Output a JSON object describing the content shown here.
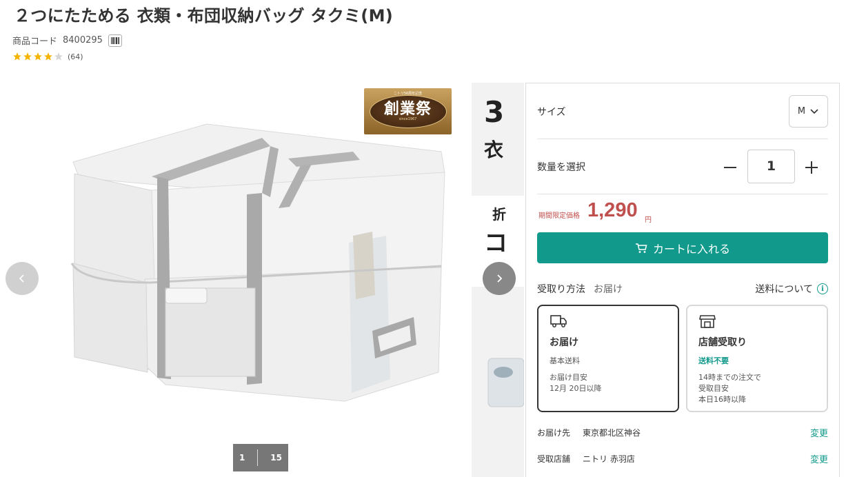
{
  "product": {
    "title": "２つにたためる 衣類・布団収納バッグ タクミ(M)",
    "code_label": "商品コード",
    "code": "8400295",
    "rating_stars": 4,
    "rating_max": 5,
    "review_count": "(64)"
  },
  "gallery": {
    "badge_top": "ニトリ56周年記念",
    "badge_main": "創業祭",
    "badge_sub": "since1967",
    "next_slide_texts": [
      "3",
      "衣",
      "折",
      "コ"
    ],
    "current_index": "1",
    "total": "15"
  },
  "purchase": {
    "size_label": "サイズ",
    "size_value": "M",
    "qty_label": "数量を選択",
    "qty_value": "1",
    "price_label": "期間限定価格",
    "price": "1,290",
    "price_unit": "円",
    "cart_button": "カートに入れる",
    "method_label": "受取り方法",
    "method_value": "お届け",
    "shipping_fee_link": "送料について"
  },
  "options": [
    {
      "title": "お届け",
      "lines": [
        "基本送料",
        "お届け目安",
        "12月 20日以降"
      ],
      "selected": true
    },
    {
      "title": "店舗受取り",
      "highlight": "送料不要",
      "lines": [
        "14時までの注文で",
        "受取目安",
        "本日16時以降"
      ],
      "selected": false
    }
  ],
  "delivery": {
    "address_label": "お届け先",
    "address_value": "東京都北区神谷",
    "address_change": "変更",
    "store_label": "受取店舗",
    "store_value": "ニトリ 赤羽店",
    "store_change": "変更"
  },
  "colors": {
    "accent": "#119a8c",
    "price": "#c0504d",
    "star": "#f5b400"
  }
}
